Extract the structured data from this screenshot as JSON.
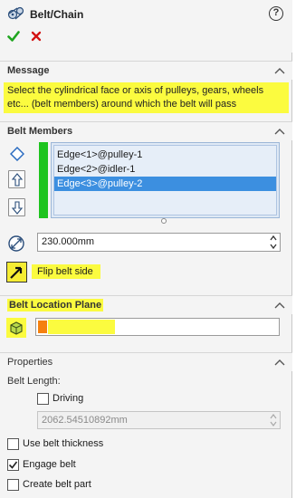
{
  "window": {
    "title": "Belt/Chain"
  },
  "icons": {
    "title": "belt-chain-icon",
    "help": "help-icon",
    "ok": "checkmark-icon",
    "cancel": "cancel-x-icon",
    "help_glyph": "?"
  },
  "colors": {
    "highlight": "#fbfb3f",
    "selection": "#3c8fe0",
    "ok_green": "#1fa51f",
    "cancel_red": "#d31212",
    "member_bar": "#1ec41e",
    "plane_marker": "#f5800f"
  },
  "message": {
    "title": "Message",
    "text": "Select the cylindrical face or axis of pulleys, gears, wheels etc... (belt members) around which the belt will pass"
  },
  "belt_members": {
    "title": "Belt Members",
    "items": [
      {
        "label": "Edge<1>@pulley-1",
        "selected": false
      },
      {
        "label": "Edge<2>@idler-1",
        "selected": false
      },
      {
        "label": "Edge<3>@pulley-2",
        "selected": true
      }
    ],
    "length_value": "230.000mm",
    "flip_label": "Flip belt side"
  },
  "belt_location_plane": {
    "title": "Belt Location Plane"
  },
  "properties": {
    "title": "Properties",
    "belt_length_label": "Belt Length:",
    "driving_label": "Driving",
    "driving_checked": false,
    "belt_length_value": "2062.54510892mm",
    "use_belt_thickness_label": "Use belt thickness",
    "use_belt_thickness_checked": false,
    "engage_belt_label": "Engage belt",
    "engage_belt_checked": true,
    "create_belt_part_label": "Create belt part",
    "create_belt_part_checked": false
  }
}
